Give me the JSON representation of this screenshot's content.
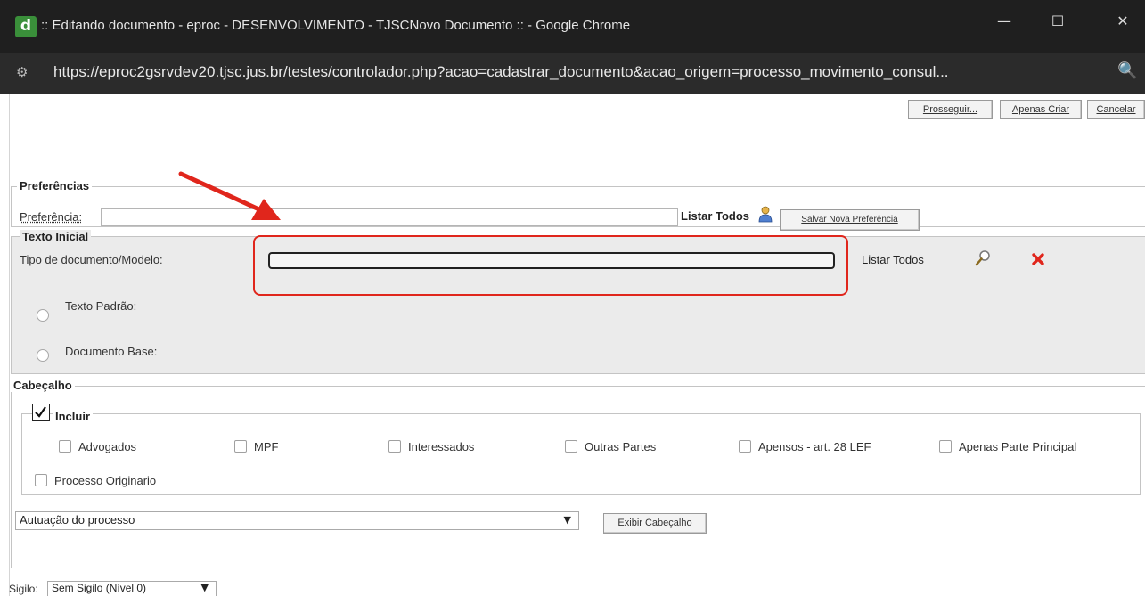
{
  "window": {
    "title": ":: Editando documento - eproc - DESENVOLVIMENTO - TJSCNovo Documento :: - Google Chrome",
    "app_icon_letter": "d",
    "minimize_glyph": "—",
    "maximize_glyph": "☐",
    "close_glyph": "✕"
  },
  "address": {
    "url": "https://eproc2gsrvdev20.tjsc.jus.br/testes/controlador.php?acao=cadastrar_documento&acao_origem=processo_movimento_consul...",
    "site_icon": "⚙",
    "zoom_icon": "🔍"
  },
  "toolbar": {
    "prosseguir": "Prosseguir...",
    "apenas_criar": "Apenas Criar",
    "cancelar": "Cancelar"
  },
  "preferencias": {
    "legend": "Preferências",
    "label": "Preferência:",
    "value": "",
    "listar_todos": "Listar Todos",
    "salvar": "Salvar Nova Preferência"
  },
  "texto_inicial": {
    "legend": "Texto Inicial",
    "tipo_label": "Tipo de documento/Modelo:",
    "tipo_value": "",
    "listar_todos": "Listar Todos",
    "texto_padrao": "Texto Padrão:",
    "documento_base": "Documento Base:"
  },
  "cabecalho": {
    "legend": "Cabeçalho",
    "incluir": "Incluir",
    "incluir_checked": true,
    "options": [
      {
        "label": "Advogados",
        "checked": false
      },
      {
        "label": "MPF",
        "checked": false
      },
      {
        "label": "Interessados",
        "checked": false
      },
      {
        "label": "Outras Partes",
        "checked": false
      },
      {
        "label": "Apensos - art. 28 LEF",
        "checked": false
      },
      {
        "label": "Apenas Parte Principal",
        "checked": false
      },
      {
        "label": "Processo Originario",
        "checked": false
      }
    ],
    "select_value": "Autuação do processo",
    "exibir": "Exibir Cabeçalho"
  },
  "sigilo": {
    "label": "Sigilo:",
    "value": "Sem Sigilo (Nível 0)"
  },
  "annotation": {
    "arrow_color": "#e0261c",
    "highlight_color": "#e0261c"
  }
}
